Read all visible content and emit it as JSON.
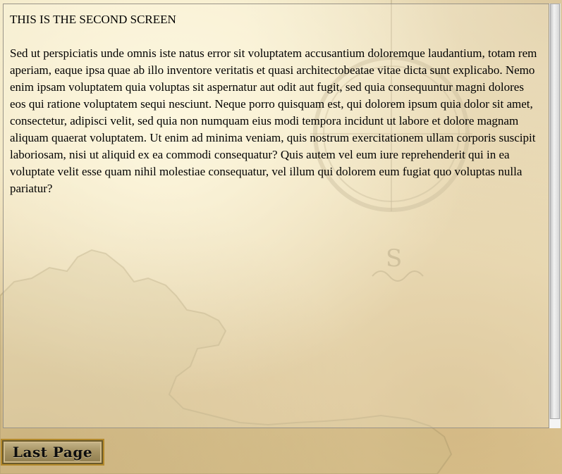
{
  "screen": {
    "heading": "THIS IS THE SECOND SCREEN",
    "body": "Sed ut perspiciatis unde omnis iste natus error sit voluptatem accusantium doloremque laudantium, totam rem aperiam, eaque ipsa quae ab illo inventore veritatis et quasi architectobeatae vitae dicta sunt explicabo. Nemo enim ipsam voluptatem quia voluptas sit aspernatur aut odit aut fugit, sed quia consequuntur magni dolores eos qui ratione voluptatem sequi nesciunt. Neque porro quisquam est, qui dolorem ipsum quia dolor sit amet, consectetur, adipisci velit, sed quia non numquam eius modi tempora incidunt ut labore et dolore magnam aliquam quaerat voluptatem. Ut enim ad minima veniam, quis nostrum exercitationem ullam corporis suscipit laboriosam, nisi ut aliquid ex ea commodi consequatur? Quis autem vel eum iure reprehenderit qui in ea voluptate velit esse quam nihil molestiae consequatur, vel illum qui dolorem eum fugiat quo voluptas nulla pariatur?"
  },
  "navigation": {
    "last_page_label": "Last Page"
  },
  "background": {
    "compass_letter": "S"
  },
  "colors": {
    "parchment": "#ecdcb2",
    "button_border": "#b48a2c",
    "text": "#000000"
  }
}
